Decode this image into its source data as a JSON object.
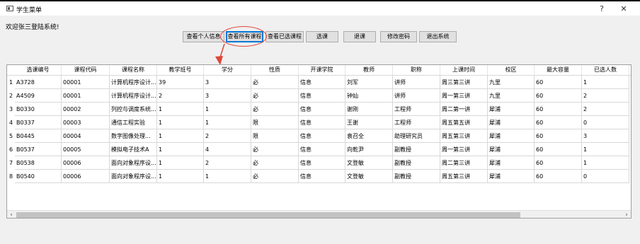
{
  "window": {
    "title": "学生菜单",
    "help_label": "?",
    "close_label": "✕"
  },
  "welcome": "欢迎张三登陆系统!",
  "toolbar": {
    "buttons": [
      {
        "label": "查看个人信息"
      },
      {
        "label": "查看所有课程"
      },
      {
        "label": "查看已选课程"
      },
      {
        "label": "选课"
      },
      {
        "label": "退课"
      },
      {
        "label": "修改密码"
      },
      {
        "label": "退出系统"
      }
    ]
  },
  "annotation_color": "#e0463a",
  "table": {
    "headers": [
      "选课编号",
      "课程代码",
      "课程名称",
      "教学班号",
      "学分",
      "性质",
      "开课学院",
      "教师",
      "职称",
      "上课时间",
      "校区",
      "最大容量",
      "已选人数"
    ],
    "rows": [
      {
        "num": "1",
        "cells": [
          "A3728",
          "00001",
          "计算机程序设计...",
          "39",
          "3",
          "必",
          "信息",
          "刘军",
          "讲师",
          "周三第三讲",
          "九里",
          "60",
          "1"
        ]
      },
      {
        "num": "2",
        "cells": [
          "A4509",
          "00001",
          "计算机程序设计...",
          "2",
          "3",
          "必",
          "信息",
          "钟灿",
          "讲师",
          "周一第三讲",
          "九里",
          "60",
          "2"
        ]
      },
      {
        "num": "3",
        "cells": [
          "B0330",
          "00002",
          "列控与调度系统...",
          "1",
          "1",
          "必",
          "信息",
          "谢刚",
          "工程师",
          "周二第一讲",
          "犀浦",
          "60",
          "2"
        ]
      },
      {
        "num": "4",
        "cells": [
          "B0337",
          "00003",
          "通信工程实验",
          "1",
          "1",
          "限",
          "信息",
          "王谢",
          "工程师",
          "周五第五讲",
          "犀浦",
          "60",
          "0"
        ]
      },
      {
        "num": "5",
        "cells": [
          "B0445",
          "00004",
          "数字图像处理...",
          "1",
          "2",
          "限",
          "信息",
          "袁召全",
          "助理研究员",
          "周五第三讲",
          "犀浦",
          "60",
          "3"
        ]
      },
      {
        "num": "6",
        "cells": [
          "B0537",
          "00005",
          "模拟电子技术A",
          "1",
          "4",
          "必",
          "信息",
          "向乾尹",
          "副教授",
          "周一第三讲",
          "犀浦",
          "60",
          "1"
        ]
      },
      {
        "num": "7",
        "cells": [
          "B0538",
          "00006",
          "面向对象程序设...",
          "1",
          "2",
          "必",
          "信息",
          "文登敏",
          "副教授",
          "周二第三讲",
          "犀浦",
          "60",
          "1"
        ]
      },
      {
        "num": "8",
        "cells": [
          "B0540",
          "00006",
          "面向对象程序设...",
          "1",
          "1",
          "必",
          "信息",
          "文登敏",
          "副教授",
          "周五第三讲",
          "犀浦",
          "60",
          "0"
        ]
      }
    ]
  },
  "scroll": {
    "left_label": "‹",
    "right_label": "›"
  }
}
